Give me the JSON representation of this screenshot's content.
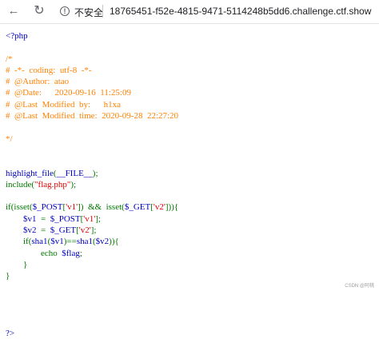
{
  "browser": {
    "insecure_label": "不安全",
    "url": "18765451-f52e-4815-9471-5114248b5dd6.challenge.ctf.show",
    "icons": [
      "back-arrow-icon",
      "reload-icon",
      "warning-info-icon"
    ]
  },
  "code_lines": [
    [
      {
        "t": "<?php",
        "c": "def"
      }
    ],
    [
      {
        "t": "",
        "c": "def"
      }
    ],
    [
      {
        "t": "/*",
        "c": "comment"
      }
    ],
    [
      {
        "t": "#  -*-  coding:  utf-8  -*-",
        "c": "comment"
      }
    ],
    [
      {
        "t": "#  @Author:  atao",
        "c": "comment"
      }
    ],
    [
      {
        "t": "#  @Date:      2020-09-16  11:25:09",
        "c": "comment"
      }
    ],
    [
      {
        "t": "#  @Last  Modified  by:      h1xa",
        "c": "comment"
      }
    ],
    [
      {
        "t": "#  @Last  Modified  time:  2020-09-28  22:27:20",
        "c": "comment"
      }
    ],
    [
      {
        "t": "",
        "c": "comment"
      }
    ],
    [
      {
        "t": "*/",
        "c": "comment"
      }
    ],
    [
      {
        "t": "",
        "c": "def"
      }
    ],
    [
      {
        "t": "",
        "c": "def"
      }
    ],
    [
      {
        "t": "highlight_file",
        "c": "def"
      },
      {
        "t": "(",
        "c": "key"
      },
      {
        "t": "__FILE__",
        "c": "def"
      },
      {
        "t": ");",
        "c": "key"
      }
    ],
    [
      {
        "t": "include(",
        "c": "key"
      },
      {
        "t": "\"flag.php\"",
        "c": "str"
      },
      {
        "t": ");",
        "c": "key"
      }
    ],
    [
      {
        "t": "",
        "c": "def"
      }
    ],
    [
      {
        "t": "if(isset(",
        "c": "key"
      },
      {
        "t": "$_POST",
        "c": "def"
      },
      {
        "t": "[",
        "c": "key"
      },
      {
        "t": "'v1'",
        "c": "str"
      },
      {
        "t": "])  &&  isset(",
        "c": "key"
      },
      {
        "t": "$_GET",
        "c": "def"
      },
      {
        "t": "[",
        "c": "key"
      },
      {
        "t": "'v2'",
        "c": "str"
      },
      {
        "t": "])){",
        "c": "key"
      }
    ],
    [
      {
        "t": "        ",
        "c": "def"
      },
      {
        "t": "$v1  ",
        "c": "def"
      },
      {
        "t": "=  ",
        "c": "key"
      },
      {
        "t": "$_POST",
        "c": "def"
      },
      {
        "t": "[",
        "c": "key"
      },
      {
        "t": "'v1'",
        "c": "str"
      },
      {
        "t": "];",
        "c": "key"
      }
    ],
    [
      {
        "t": "        ",
        "c": "def"
      },
      {
        "t": "$v2  ",
        "c": "def"
      },
      {
        "t": "=  ",
        "c": "key"
      },
      {
        "t": "$_GET",
        "c": "def"
      },
      {
        "t": "[",
        "c": "key"
      },
      {
        "t": "'v2'",
        "c": "str"
      },
      {
        "t": "];",
        "c": "key"
      }
    ],
    [
      {
        "t": "        ",
        "c": "def"
      },
      {
        "t": "if(",
        "c": "key"
      },
      {
        "t": "sha1",
        "c": "def"
      },
      {
        "t": "(",
        "c": "key"
      },
      {
        "t": "$v1",
        "c": "def"
      },
      {
        "t": ")==",
        "c": "key"
      },
      {
        "t": "sha1",
        "c": "def"
      },
      {
        "t": "(",
        "c": "key"
      },
      {
        "t": "$v2",
        "c": "def"
      },
      {
        "t": ")){",
        "c": "key"
      }
    ],
    [
      {
        "t": "                ",
        "c": "def"
      },
      {
        "t": "echo  ",
        "c": "key"
      },
      {
        "t": "$flag",
        "c": "def"
      },
      {
        "t": ";",
        "c": "key"
      }
    ],
    [
      {
        "t": "        ",
        "c": "def"
      },
      {
        "t": "}",
        "c": "key"
      }
    ],
    [
      {
        "t": "}",
        "c": "key"
      }
    ],
    [
      {
        "t": "",
        "c": "def"
      }
    ],
    [
      {
        "t": "",
        "c": "def"
      }
    ],
    [
      {
        "t": "",
        "c": "def"
      }
    ],
    [
      {
        "t": "",
        "c": "def"
      }
    ],
    [
      {
        "t": "?>",
        "c": "def"
      }
    ]
  ],
  "watermark": "CSDN @阿桃"
}
